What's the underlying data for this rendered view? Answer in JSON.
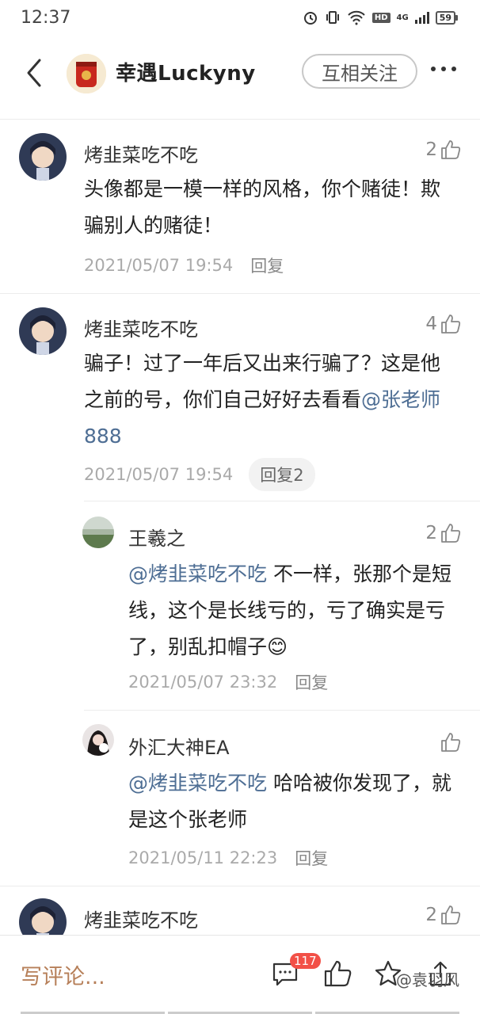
{
  "status_bar": {
    "time": "12:37",
    "hd": "HD",
    "network": "4G",
    "battery": "59"
  },
  "header": {
    "title": "幸遇Luckyny",
    "follow_label": "互相关注"
  },
  "comments": [
    {
      "name": "烤韭菜吃不吃",
      "likes": "2",
      "text": "头像都是一模一样的风格，你个赌徒！欺骗别人的赌徒！",
      "date": "2021/05/07 19:54",
      "reply_label": "回复"
    },
    {
      "name": "烤韭菜吃不吃",
      "likes": "4",
      "text_before": "骗子！过了一年后又出来行骗了？这是他之前的号，你们自己好好去看看",
      "mention": "@张老师888",
      "date": "2021/05/07 19:54",
      "reply_label": "回复2"
    },
    {
      "name": "王羲之",
      "likes": "2",
      "mention": "@烤韭菜吃不吃",
      "text_after": " 不一样，张那个是短线，这个是长线亏的，亏了确实是亏了，别乱扣帽子😊",
      "date": "2021/05/07 23:32",
      "reply_label": "回复"
    },
    {
      "name": "外汇大神EA",
      "likes": "",
      "mention": "@烤韭菜吃不吃",
      "text_after": " 哈哈被你发现了，就是这个张老师",
      "date": "2021/05/11 22:23",
      "reply_label": "回复"
    },
    {
      "name": "烤韭菜吃不吃",
      "likes": "2"
    }
  ],
  "bottom_bar": {
    "write_comment": "写评论...",
    "comment_count": "117",
    "watermark": "@袁羽风"
  },
  "icons": [
    "back-icon",
    "more-icon",
    "thumb-up-icon",
    "comment-icon",
    "star-icon",
    "share-icon"
  ],
  "colors": {
    "mention": "#4e6e94",
    "write_comment": "#b7805a",
    "badge": "#f25047"
  }
}
